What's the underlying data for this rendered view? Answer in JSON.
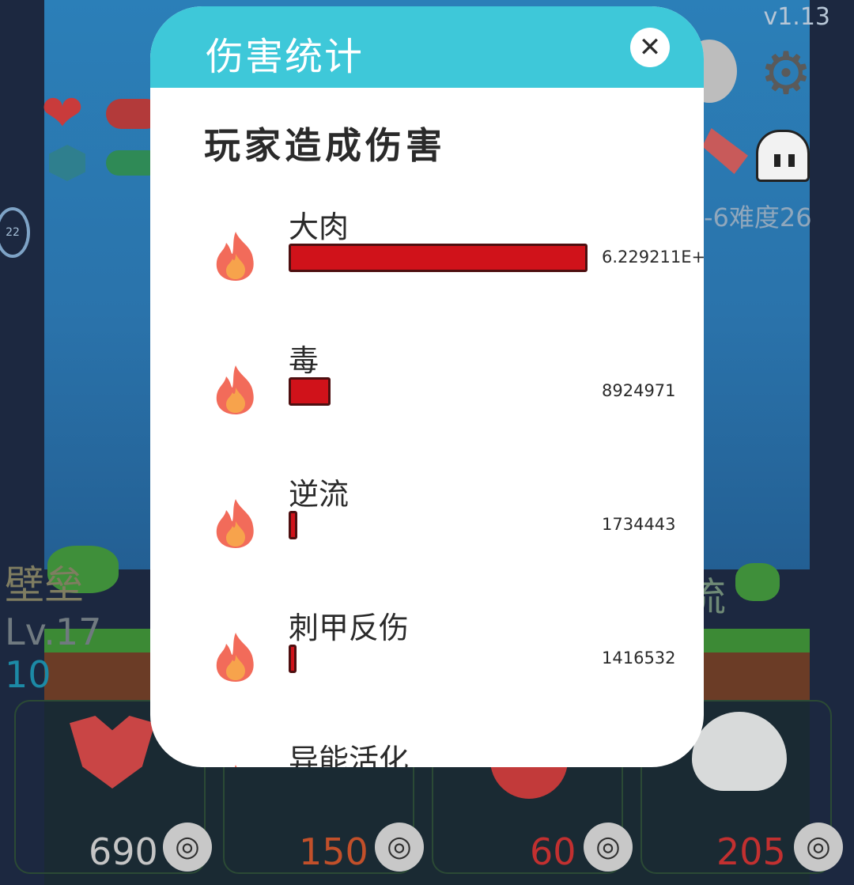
{
  "game": {
    "version": "v1.13",
    "difficulty_text": "-6难度26",
    "side_name": "壁垒",
    "side_level": "Lv.17",
    "side_number": "10",
    "right_char": "流",
    "timer_text": "22"
  },
  "cards": [
    {
      "value": "690",
      "color": "#c5c5c5"
    },
    {
      "value": "150",
      "color": "#c2502a"
    },
    {
      "value": "60",
      "color": "#c23030"
    },
    {
      "value": "205",
      "color": "#c23030"
    }
  ],
  "modal": {
    "title": "伤害统计",
    "close_icon": "close-icon",
    "section_title": "玩家造成伤害",
    "rows": [
      {
        "label": "大肉",
        "value": "6.229211E+",
        "bar_fraction": 1.0
      },
      {
        "label": "毒",
        "value": "8924971",
        "bar_fraction": 0.14
      },
      {
        "label": "逆流",
        "value": "1734443",
        "bar_fraction": 0.028
      },
      {
        "label": "刺甲反伤",
        "value": "1416532",
        "bar_fraction": 0.023
      },
      {
        "label": "异能活化",
        "value": "",
        "bar_fraction": 0
      }
    ]
  },
  "colors": {
    "header": "#3ec8d9",
    "bar_fill": "#d0121a",
    "bar_border": "#4d0f10"
  }
}
